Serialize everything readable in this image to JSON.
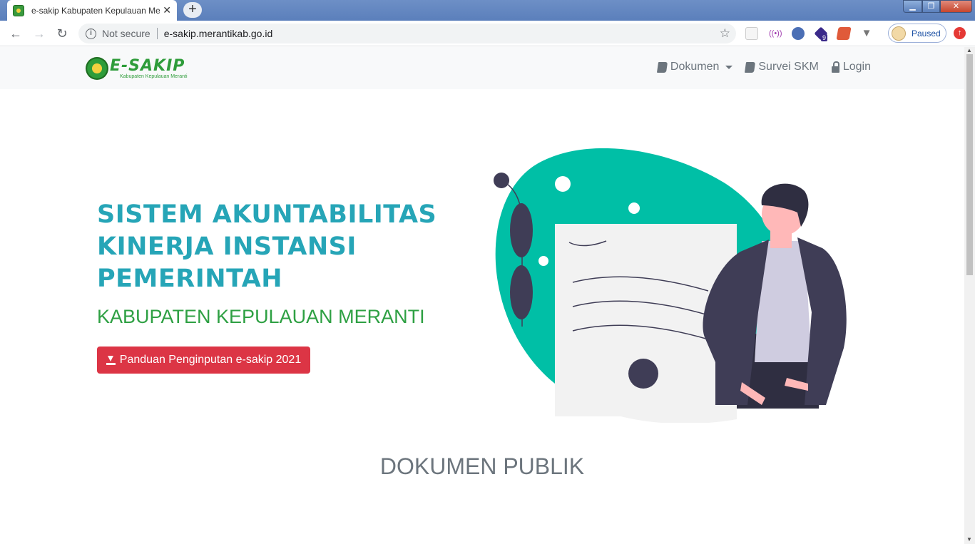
{
  "browser": {
    "tab_title": "e-sakip Kabupaten Kepulauan Meranti",
    "tab_close": "✕",
    "new_tab": "+",
    "security_label": "Not secure",
    "url": "e-sakip.merantikab.go.id",
    "profile_status": "Paused",
    "extension_badge": "9"
  },
  "site": {
    "logo_main": "E-SAKIP",
    "logo_sub": "Kabupaten Kepulauan Meranti",
    "nav": {
      "dokumen": "Dokumen",
      "survei": "Survei SKM",
      "login": "Login"
    }
  },
  "hero": {
    "title_line1": "SISTEM AKUNTABILITAS",
    "title_line2": "KINERJA INSTANSI",
    "title_line3": "PEMERINTAH",
    "subtitle": "KABUPATEN KEPULAUAN MERANTI",
    "button": "Panduan Penginputan e-sakip 2021"
  },
  "section": {
    "title": "DOKUMEN PUBLIK"
  },
  "colors": {
    "title_teal": "#26a5b7",
    "subtitle_green": "#2ea043",
    "button_red": "#dc3545",
    "blob_teal": "#00bfa6"
  }
}
